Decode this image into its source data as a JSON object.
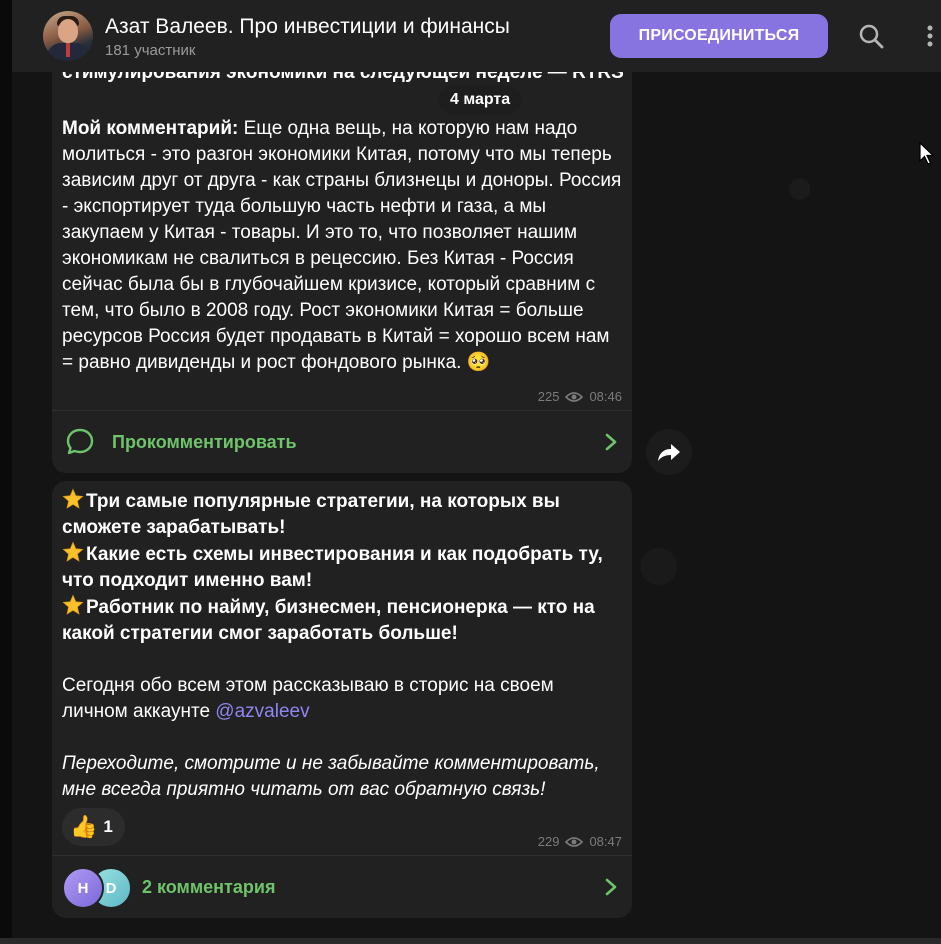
{
  "header": {
    "title": "Азат Валеев. Про инвестиции и финансы",
    "members": "181 участник",
    "join_label": "ПРИСОЕДИНИТЬСЯ",
    "icons": [
      "search-icon",
      "more-vertical-icon"
    ]
  },
  "date_separator": "4 марта",
  "message1": {
    "cut_heading": "стимулирования экономики на следующей неделе — RTRS",
    "comment_prefix": "Мой комментарий:",
    "body": " Еще одна вещь, на которую нам надо молиться - это разгон экономики Китая, потому что мы теперь зависим друг от друга - как страны близнецы и доноры. Россия - экспортирует туда большую часть нефти и газа, а мы закупаем у Китая - товары. И это то, что позволяет нашим экономикам не свалиться в рецессию. Без Китая - Россия сейчас была бы в глубочайшем кризисе, который сравним с тем, что было в 2008 году. Рост экономики Китая = больше ресурсов Россия будет продавать в Китай = хорошо всем нам = равно дивиденды и рост фондового рынка. 🥺",
    "views": "225",
    "time": "08:46",
    "comment_action": "Прокомментировать"
  },
  "message2": {
    "line1": "Три самые популярные стратегии, на которых вы сможете зарабатывать!",
    "line2": "Какие есть схемы инвестирования и как подобрать ту, что подходит именно вам!",
    "line3": "Работник по найму, бизнесмен, пенсионерка — кто на какой стратегии смог заработать больше!",
    "para_text": "Сегодня обо всем этом рассказываю в сторис на своем личном аккаунте ",
    "mention": "@azvaleev",
    "italic_text": "Переходите, смотрите и не забывайте комментировать, мне всегда приятно читать от вас обратную связь!",
    "reaction_emoji": "👍",
    "reaction_count": "1",
    "views": "229",
    "time": "08:47",
    "avatar1": "H",
    "avatar2": "D",
    "comments_label": "2 комментария"
  },
  "colors": {
    "accent": "#8774e1",
    "comment_green": "#6fc36a",
    "mention": "#8f86f0"
  }
}
